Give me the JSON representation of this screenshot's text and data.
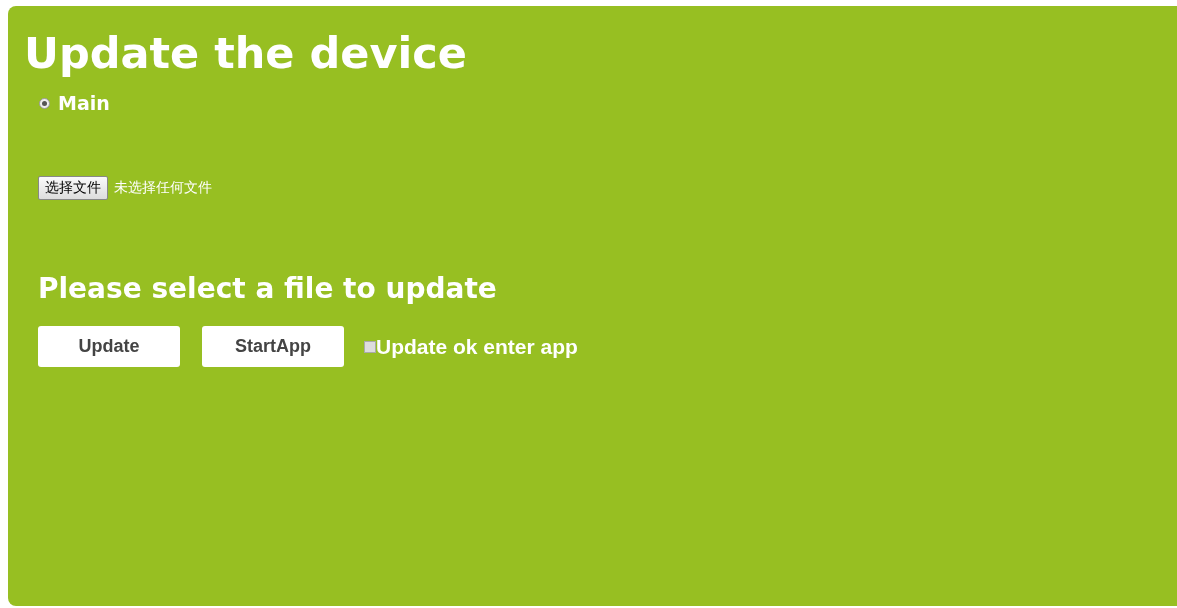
{
  "title": "Update the device",
  "radio": {
    "label": "Main",
    "selected": true
  },
  "file_input": {
    "button": "选择文件",
    "status": "未选择任何文件"
  },
  "prompt": "Please select a file to update",
  "buttons": [
    "Update",
    "StartApp"
  ],
  "checkbox": {
    "label": "Update ok enter app",
    "checked": false
  }
}
